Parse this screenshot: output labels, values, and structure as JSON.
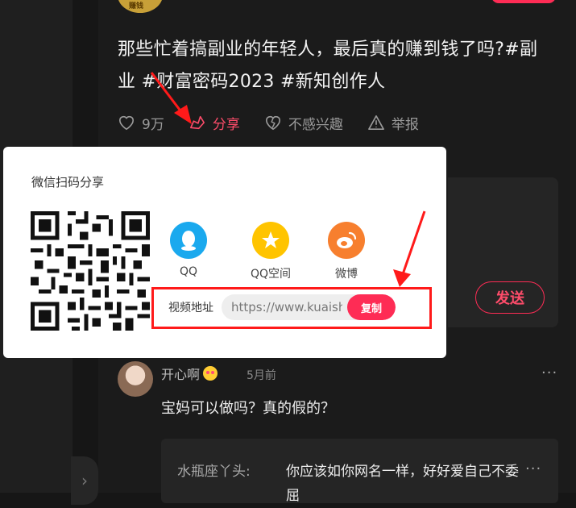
{
  "video": {
    "title": "那些忙着搞副业的年轻人，最后真的赚到钱了吗?#副业 #财富密码2023 #新知创作人",
    "avatar_text": "赚钱"
  },
  "actions": {
    "like_count": "9万",
    "share_label": "分享",
    "not_interested_label": "不感兴趣",
    "report_label": "举报"
  },
  "share_popup": {
    "title": "微信扫码分享",
    "options": [
      {
        "label": "QQ",
        "icon": "qq-icon",
        "color": "#1aa9ee"
      },
      {
        "label": "QQ空间",
        "icon": "qzone-icon",
        "color": "#ffc400"
      },
      {
        "label": "微博",
        "icon": "weibo-icon",
        "color": "#f77f2e"
      }
    ],
    "url_label": "视频地址",
    "url_value": "https://www.kuaishou.com",
    "copy_label": "复制"
  },
  "comment_input": {
    "send_label": "发送"
  },
  "comments": [
    {
      "user": "开心啊",
      "time": "5月前",
      "text": "宝妈可以做吗？真的假的？",
      "reply": {
        "user": "水瓶座丫头:",
        "text": "你应该如你网名一样，好好爱自己不委屈"
      }
    }
  ],
  "colors": {
    "accent": "#fe2c55",
    "annotation": "#ff1a1a"
  }
}
